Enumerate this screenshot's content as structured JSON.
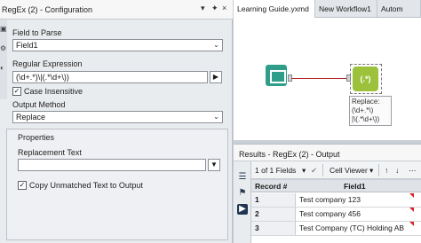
{
  "config": {
    "title": "RegEx (2) - Configuration",
    "pin_glyph": "▾ ✦ ×",
    "field_to_parse_label": "Field to Parse",
    "field_to_parse_value": "Field1",
    "regex_label": "Regular Expression",
    "regex_value": "(\\d+.*)\\|(.*\\d+\\))",
    "case_insensitive_label": "Case Insensitive",
    "case_insensitive_checked": true,
    "output_method_label": "Output Method",
    "output_method_value": "Replace",
    "properties_label": "Properties",
    "replacement_label": "Replacement Text",
    "replacement_value": "",
    "copy_unmatched_label": "Copy Unmatched Text to Output",
    "copy_unmatched_checked": true
  },
  "tabs": [
    "Learning Guide.yxmd",
    "New Workflow1",
    "Autom"
  ],
  "canvas": {
    "annotation_lines": [
      "Replace:",
      "(\\d+.*\\)",
      "|\\(.*\\d+\\))"
    ],
    "regex_tool_glyph": "(.*)"
  },
  "results": {
    "title": "Results - RegEx (2) - Output",
    "fields_selector": "1 of 1 Fields",
    "cell_viewer": "Cell Viewer",
    "columns": [
      "Record #",
      "Field1"
    ],
    "rows": [
      {
        "num": "1",
        "value": "Test company 123"
      },
      {
        "num": "2",
        "value": "Test company 456"
      },
      {
        "num": "3",
        "value": "Test Company (TC) Holding AB"
      }
    ]
  },
  "colors": {
    "input_tool": "#2e9e8a",
    "regex_tool": "#9cc13a",
    "connector": "#b0282a"
  }
}
